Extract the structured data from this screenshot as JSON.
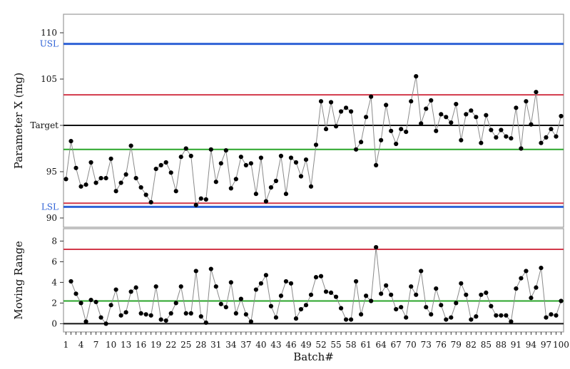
{
  "chart_data": [
    {
      "type": "line",
      "ylabel": "Parameter X (mg)",
      "ylim": [
        89.0,
        112.0
      ],
      "yticks": [
        90,
        95,
        100,
        105,
        110
      ],
      "ytick_labels": [
        "90",
        "95",
        "",
        "105",
        "110"
      ],
      "reference_lines": [
        {
          "label": "USL",
          "value": 108.8,
          "color": "#2f62d6"
        },
        {
          "label": "",
          "value": 103.3,
          "color": "#d2384a"
        },
        {
          "label": "Target",
          "value": 100.0,
          "color": "#111111"
        },
        {
          "label": "",
          "value": 97.4,
          "color": "#2aa52a"
        },
        {
          "label": "",
          "value": 91.6,
          "color": "#d2384a"
        },
        {
          "label": "LSL",
          "value": 91.2,
          "color": "#2f62d6"
        }
      ],
      "series": [
        {
          "x": [
            1,
            2,
            3,
            4,
            5,
            6,
            7,
            8,
            9,
            10,
            11,
            12,
            13,
            14,
            15,
            16,
            17,
            18,
            19,
            20,
            21,
            22,
            23,
            24,
            25,
            26,
            27,
            28,
            29,
            30,
            31,
            32,
            33,
            34,
            35,
            36,
            37,
            38,
            39,
            40,
            41,
            42,
            43,
            44,
            45,
            46,
            47,
            48,
            49,
            50,
            51,
            52,
            53,
            54,
            55,
            56,
            57,
            58,
            59,
            60,
            61,
            62,
            63,
            64,
            65,
            66,
            67,
            68,
            69,
            70,
            71,
            72,
            73,
            74,
            75,
            76,
            77,
            78,
            79,
            80,
            81,
            82,
            83,
            84,
            85,
            86,
            87,
            88,
            89,
            90,
            91,
            92,
            93,
            94,
            95,
            96,
            97,
            98,
            99,
            100
          ],
          "values": [
            94.2,
            98.3,
            95.4,
            93.4,
            93.6,
            96.0,
            93.8,
            94.3,
            94.3,
            96.4,
            92.9,
            93.8,
            94.7,
            97.8,
            94.3,
            93.3,
            92.5,
            91.7,
            95.3,
            95.7,
            96.0,
            94.9,
            92.9,
            96.6,
            97.5,
            96.7,
            91.4,
            92.1,
            92.0,
            97.4,
            93.9,
            95.9,
            97.3,
            93.2,
            94.2,
            96.6,
            95.7,
            95.9,
            92.6,
            96.5,
            91.8,
            93.3,
            94.0,
            96.7,
            92.6,
            96.5,
            96.0,
            94.5,
            96.3,
            93.4,
            97.9,
            102.6,
            99.6,
            102.5,
            99.9,
            101.5,
            101.9,
            101.5,
            97.4,
            98.2,
            100.9,
            103.1,
            95.7,
            98.4,
            102.2,
            99.4,
            98.0,
            99.6,
            99.3,
            102.6,
            105.3,
            100.2,
            101.8,
            102.7,
            99.4,
            101.2,
            100.9,
            100.3,
            102.3,
            98.4,
            101.2,
            101.6,
            100.9,
            98.1,
            101.1,
            99.5,
            98.7,
            99.5,
            98.8,
            98.6,
            101.9,
            97.5,
            102.6,
            100.1,
            103.6,
            98.1,
            98.7,
            99.6,
            98.8,
            101.0
          ]
        }
      ]
    },
    {
      "type": "line",
      "ylabel": "Moving Range",
      "xlabel": "Batch#",
      "ylim": [
        -0.8,
        9.2
      ],
      "yticks": [
        0,
        2,
        4,
        6,
        8
      ],
      "reference_lines": [
        {
          "label": "",
          "value": 7.2,
          "color": "#d2384a"
        },
        {
          "label": "",
          "value": 2.2,
          "color": "#2aa52a"
        },
        {
          "label": "",
          "value": 0.0,
          "color": "#111111"
        }
      ],
      "x_tick_labels": [
        "1",
        "4",
        "7",
        "10",
        "13",
        "16",
        "19",
        "22",
        "25",
        "28",
        "31",
        "34",
        "37",
        "40",
        "43",
        "46",
        "49",
        "52",
        "55",
        "58",
        "61",
        "64",
        "67",
        "70",
        "73",
        "76",
        "79",
        "82",
        "85",
        "88",
        "91",
        "94",
        "97",
        "100"
      ],
      "series": [
        {
          "x": [
            2,
            3,
            4,
            5,
            6,
            7,
            8,
            9,
            10,
            11,
            12,
            13,
            14,
            15,
            16,
            17,
            18,
            19,
            20,
            21,
            22,
            23,
            24,
            25,
            26,
            27,
            28,
            29,
            30,
            31,
            32,
            33,
            34,
            35,
            36,
            37,
            38,
            39,
            40,
            41,
            42,
            43,
            44,
            45,
            46,
            47,
            48,
            49,
            50,
            51,
            52,
            53,
            54,
            55,
            56,
            57,
            58,
            59,
            60,
            61,
            62,
            63,
            64,
            65,
            66,
            67,
            68,
            69,
            70,
            71,
            72,
            73,
            74,
            75,
            76,
            77,
            78,
            79,
            80,
            81,
            82,
            83,
            84,
            85,
            86,
            87,
            88,
            89,
            90,
            91,
            92,
            93,
            94,
            95,
            96,
            97,
            98,
            99,
            100
          ],
          "values": [
            4.1,
            2.9,
            2.0,
            0.2,
            2.3,
            2.1,
            0.6,
            0.0,
            1.8,
            3.3,
            0.8,
            1.1,
            3.1,
            3.5,
            1.0,
            0.9,
            0.8,
            3.6,
            0.4,
            0.3,
            1.0,
            2.0,
            3.6,
            1.0,
            1.0,
            5.1,
            0.7,
            0.1,
            5.3,
            3.6,
            1.9,
            1.6,
            4.0,
            1.0,
            2.4,
            0.9,
            0.2,
            3.3,
            3.9,
            4.7,
            1.7,
            0.6,
            2.7,
            4.1,
            3.9,
            0.5,
            1.4,
            1.8,
            2.8,
            4.5,
            4.6,
            3.1,
            3.0,
            2.6,
            1.5,
            0.4,
            0.4,
            4.1,
            0.9,
            2.7,
            2.2,
            7.4,
            2.9,
            3.7,
            2.8,
            1.4,
            1.6,
            0.6,
            3.6,
            2.8,
            5.1,
            1.6,
            0.9,
            3.4,
            1.8,
            0.4,
            0.6,
            2.0,
            3.9,
            2.8,
            0.4,
            0.7,
            2.8,
            3.0,
            1.7,
            0.8,
            0.8,
            0.8,
            0.2,
            3.4,
            4.4,
            5.1,
            2.5,
            3.5,
            5.4,
            0.6,
            0.9,
            0.8,
            2.2
          ]
        }
      ]
    }
  ]
}
